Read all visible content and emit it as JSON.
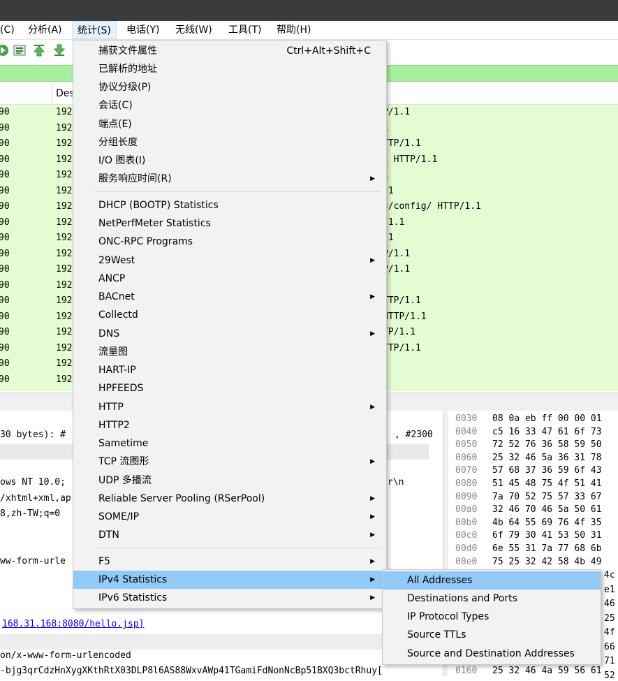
{
  "menubar": {
    "items": [
      {
        "label": "(C)"
      },
      {
        "label": "分析(A)"
      },
      {
        "label": "统计(S)"
      },
      {
        "label": "电话(Y)"
      },
      {
        "label": "无线(W)"
      },
      {
        "label": "工具(T)"
      },
      {
        "label": "帮助(H)"
      }
    ]
  },
  "packet_list": {
    "header": {
      "col_dest": "Des"
    },
    "rows": [
      {
        "c0": "90",
        "c1": "192",
        "c2": "P/1.1"
      },
      {
        "c0": "90",
        "c1": "192",
        "c2": "1"
      },
      {
        "c0": "90",
        "c1": "192",
        "c2": "TTP/1.1"
      },
      {
        "c0": "90",
        "c1": "192",
        "c2": "l HTTP/1.1"
      },
      {
        "c0": "90",
        "c1": "192",
        "c2": "1"
      },
      {
        "c0": "90",
        "c1": "192",
        "c2": ".1"
      },
      {
        "c0": "90",
        "c1": "192",
        "c2": "s/config/ HTTP/1.1"
      },
      {
        "c0": "90",
        "c1": "192",
        "c2": "/1.1"
      },
      {
        "c0": "90",
        "c1": "192",
        "c2": ".1"
      },
      {
        "c0": "90",
        "c1": "192",
        "c2": "P/1.1"
      },
      {
        "c0": "90",
        "c1": "192",
        "c2": "P/1.1"
      },
      {
        "c0": "90",
        "c1": "192",
        "c2": ""
      },
      {
        "c0": "90",
        "c1": "192",
        "c2": "TTP/1.1"
      },
      {
        "c0": "90",
        "c1": "192",
        "c2": "HTTP/1.1"
      },
      {
        "c0": "90",
        "c1": "192",
        "c2": "TP/1.1"
      },
      {
        "c0": "90",
        "c1": "192",
        "c2": "TTP/1.1"
      },
      {
        "c0": "90",
        "c1": "192",
        "c2": ""
      },
      {
        "c0": "90",
        "c1": "192",
        "c2": ""
      }
    ]
  },
  "details": {
    "line_frame": "30 bytes): #",
    "line_frame_right": ", #2300",
    "line_ua": "ows NT 10.0;",
    "line_ua_right": "r\\n",
    "line_accept": "/xhtml+xml,ap",
    "line_lang": "8,zh-TW;q=0",
    "line_ctype": "ww-form-urle",
    "line_link": "168.31.168:8080/hello.jsp]",
    "line_ctype2": "on/x-www-form-urlencoded",
    "line_body": "-bjg3qrCdzHnXygXKthRtX03DLP8l6AS88WxvAWp41TGamiFdNonNcBp51BXQ3bctRhuy["
  },
  "bytes": {
    "rows": [
      {
        "off": "0030",
        "hex": "08 0a eb ff 00 00 01"
      },
      {
        "off": "0040",
        "hex": "c5 16 33 47 61 6f 73"
      },
      {
        "off": "0050",
        "hex": "72 52 76 36 58 59 50"
      },
      {
        "off": "0060",
        "hex": "25 32 46 5a 36 31 78"
      },
      {
        "off": "0070",
        "hex": "57 68 37 36 59 6f 43"
      },
      {
        "off": "0080",
        "hex": "51 45 48 75 4f 51 41"
      },
      {
        "off": "0090",
        "hex": "7a 70 52 75 57 33 67"
      },
      {
        "off": "00a0",
        "hex": "32 46 70 46 5a 50 61"
      },
      {
        "off": "00b0",
        "hex": "4b 64 55 69 76 4f 35"
      },
      {
        "off": "00c0",
        "hex": "6f 79 30 41 53 50 31"
      },
      {
        "off": "00d0",
        "hex": "6e 55 31 7a 77 68 6b"
      },
      {
        "off": "00e0",
        "hex": "75 25 32 42 58 4b 49"
      }
    ],
    "right_tail": [
      "4c",
      "e1",
      "46",
      "25",
      "4f",
      "66",
      "71",
      "52"
    ],
    "last": {
      "off": "0160",
      "hex": "25 32 46 4a 59 56 61"
    }
  },
  "stats_menu": {
    "items": [
      {
        "label": "捕获文件属性",
        "shortcut": "Ctrl+Alt+Shift+C"
      },
      {
        "label": "已解析的地址"
      },
      {
        "label": "协议分级(P)"
      },
      {
        "label": "会话(C)"
      },
      {
        "label": "端点(E)"
      },
      {
        "label": "分组长度"
      },
      {
        "label": "I/O 图表(I)"
      },
      {
        "label": "服务响应时间(R)",
        "submenu": true
      },
      {
        "label": "DHCP (BOOTP) Statistics"
      },
      {
        "label": "NetPerfMeter Statistics"
      },
      {
        "label": "ONC-RPC Programs"
      },
      {
        "label": "29West",
        "submenu": true
      },
      {
        "label": "ANCP"
      },
      {
        "label": "BACnet",
        "submenu": true
      },
      {
        "label": "Collectd"
      },
      {
        "label": "DNS",
        "submenu": true
      },
      {
        "label": "流量图"
      },
      {
        "label": "HART-IP"
      },
      {
        "label": "HPFEEDS"
      },
      {
        "label": "HTTP",
        "submenu": true
      },
      {
        "label": "HTTP2"
      },
      {
        "label": "Sametime"
      },
      {
        "label": "TCP 流图形",
        "submenu": true
      },
      {
        "label": "UDP 多播流"
      },
      {
        "label": "Reliable Server Pooling (RSerPool)",
        "submenu": true
      },
      {
        "label": "SOME/IP",
        "submenu": true
      },
      {
        "label": "DTN",
        "submenu": true
      },
      {
        "label": "F5",
        "submenu": true
      },
      {
        "label": "IPv4 Statistics",
        "submenu": true
      },
      {
        "label": "IPv6 Statistics",
        "submenu": true
      }
    ],
    "arrow": "▶"
  },
  "ipv4_submenu": {
    "items": [
      {
        "label": "All Addresses"
      },
      {
        "label": "Destinations and Ports"
      },
      {
        "label": "IP Protocol Types"
      },
      {
        "label": "Source TTLs"
      },
      {
        "label": "Source and Destination Addresses"
      }
    ]
  },
  "colors": {
    "filter_green": "#a8f0a0",
    "row_green": "#e4fcd2",
    "highlight": "#91c9f7"
  }
}
